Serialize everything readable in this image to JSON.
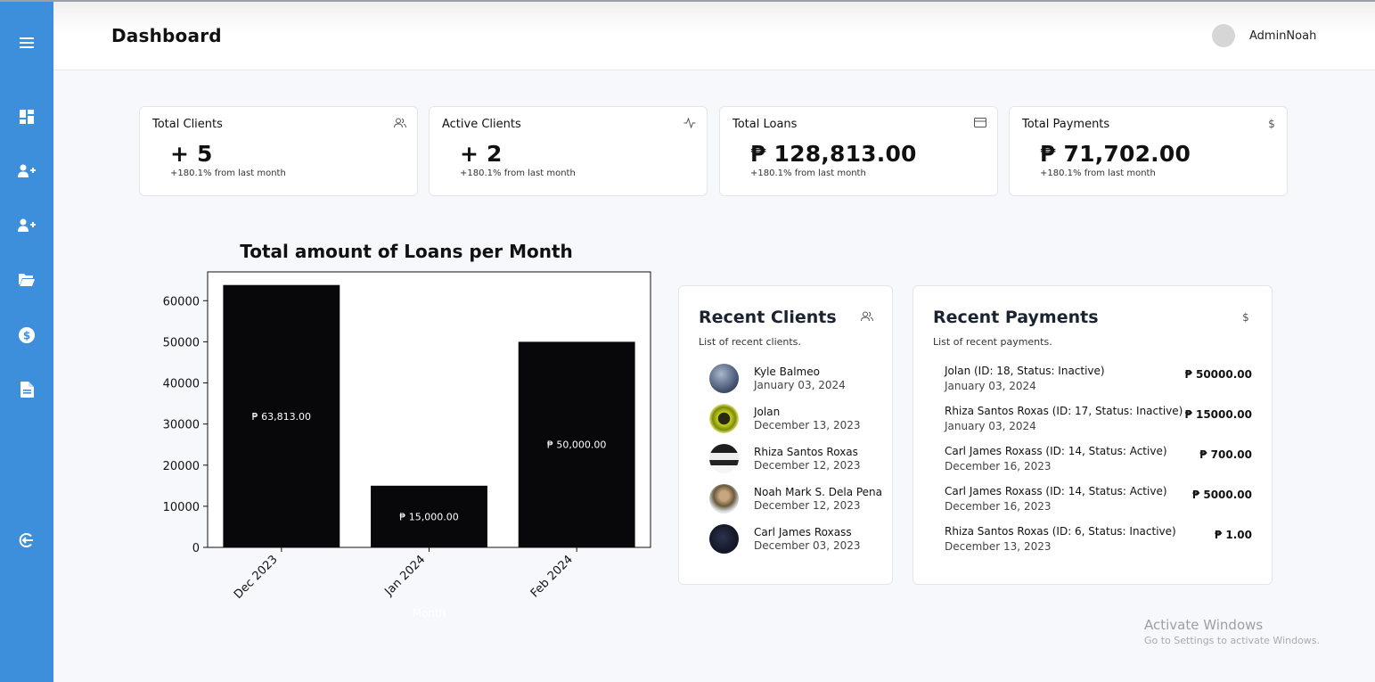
{
  "header": {
    "title": "Dashboard",
    "username": "AdminNoah"
  },
  "sidebar": {
    "items": [
      {
        "icon": "menu-icon"
      },
      {
        "icon": "dashboard-icon"
      },
      {
        "icon": "add-user-icon"
      },
      {
        "icon": "add-user-icon"
      },
      {
        "icon": "folder-icon"
      },
      {
        "icon": "dollar-circle-icon"
      },
      {
        "icon": "document-icon"
      },
      {
        "icon": "logout-icon"
      }
    ]
  },
  "stats": [
    {
      "label": "Total Clients",
      "value": "+ 5",
      "note": "+180.1% from last month",
      "icon": "users-icon"
    },
    {
      "label": "Active Clients",
      "value": "+ 2",
      "note": "+180.1% from last month",
      "icon": "activity-icon"
    },
    {
      "label": "Total Loans",
      "value": "₱ 128,813.00",
      "note": "+180.1% from last month",
      "icon": "credit-card-icon"
    },
    {
      "label": "Total Payments",
      "value": "₱ 71,702.00",
      "note": "+180.1% from last month",
      "icon": "dollar-icon"
    }
  ],
  "chart_data": {
    "type": "bar",
    "title": "Total amount of Loans per Month",
    "xlabel": "Month",
    "ylabel": "",
    "categories": [
      "Dec 2023",
      "Jan 2024",
      "Feb 2024"
    ],
    "values": [
      63813,
      15000,
      50000
    ],
    "data_labels": [
      "₱ 63,813.00",
      "₱ 15,000.00",
      "₱ 50,000.00"
    ],
    "yticks": [
      0,
      10000,
      20000,
      30000,
      40000,
      50000,
      60000
    ],
    "ylim": [
      0,
      67000
    ],
    "bar_color": "#08080b",
    "grid": false
  },
  "recent_clients": {
    "title": "Recent Clients",
    "subtitle": "List of recent clients.",
    "items": [
      {
        "name": "Kyle Balmeo",
        "date": "January 03, 2024",
        "avatar_color": "#4a5a78"
      },
      {
        "name": "Jolan",
        "date": "December 13, 2023",
        "avatar_color": "#a8b818"
      },
      {
        "name": "Rhiza Santos Roxas",
        "date": "December 12, 2023",
        "avatar_color": "#2a2a2a"
      },
      {
        "name": "Noah Mark S. Dela Pena",
        "date": "December 12, 2023",
        "avatar_color": "#8a7a5a"
      },
      {
        "name": "Carl James Roxass",
        "date": "December 03, 2023",
        "avatar_color": "#141826"
      }
    ]
  },
  "recent_payments": {
    "title": "Recent Payments",
    "subtitle": "List of recent payments.",
    "items": [
      {
        "name": "Jolan (ID: 18, Status: Inactive)",
        "date": "January 03, 2024",
        "amount": "₱ 50000.00"
      },
      {
        "name": "Rhiza Santos Roxas (ID: 17, Status: Inactive)",
        "date": "January 03, 2024",
        "amount": "₱ 15000.00"
      },
      {
        "name": "Carl James Roxass (ID: 14, Status: Active)",
        "date": "December 16, 2023",
        "amount": "₱ 700.00"
      },
      {
        "name": "Carl James Roxass (ID: 14, Status: Active)",
        "date": "December 16, 2023",
        "amount": "₱ 5000.00"
      },
      {
        "name": "Rhiza Santos Roxas (ID: 6, Status: Inactive)",
        "date": "December 13, 2023",
        "amount": "₱ 1.00"
      }
    ]
  },
  "watermark": {
    "title": "Activate Windows",
    "subtitle": "Go to Settings to activate Windows."
  },
  "colors": {
    "sidebar": "#3d8fdc",
    "background": "#f7f8fb",
    "bar": "#08080b"
  }
}
